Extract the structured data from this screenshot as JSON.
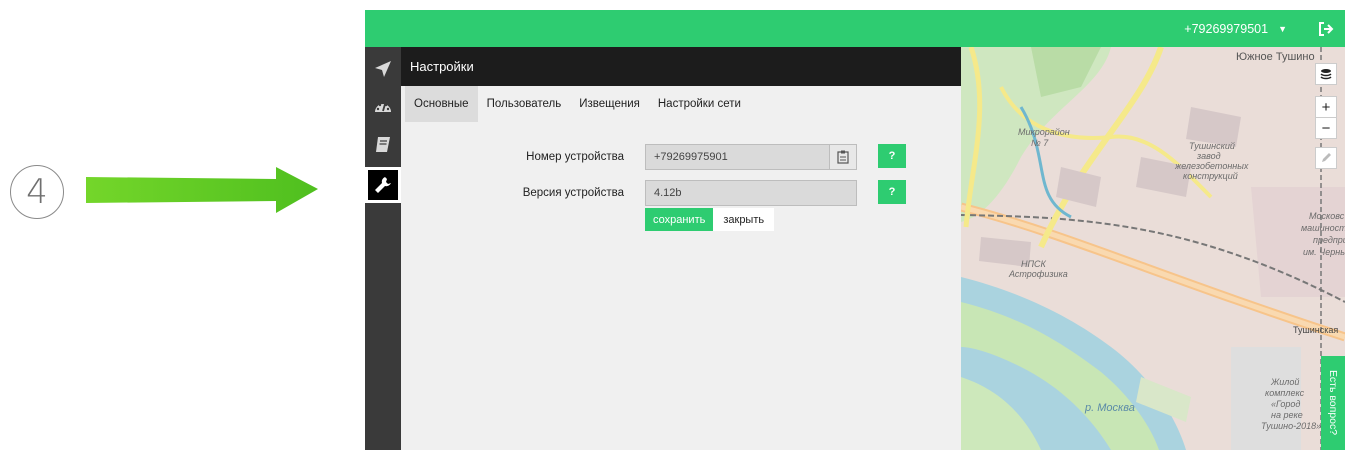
{
  "annotation": {
    "step_number": "4"
  },
  "topbar": {
    "phone": "+79269979501",
    "logout_icon": "sign-out-icon",
    "caret_icon": "caret-down-icon"
  },
  "sidebar": {
    "items": [
      {
        "icon": "location-arrow-icon"
      },
      {
        "icon": "dashboard-icon"
      },
      {
        "icon": "book-icon"
      },
      {
        "icon": "wrench-icon",
        "active": true
      }
    ]
  },
  "panel": {
    "title": "Настройки",
    "tabs": [
      {
        "label": "Основные",
        "active": true
      },
      {
        "label": "Пользователь"
      },
      {
        "label": "Извещения"
      },
      {
        "label": "Настройки сети"
      }
    ],
    "fields": {
      "device_number": {
        "label": "Номер устройства",
        "value": "+79269975901"
      },
      "device_version": {
        "label": "Версия устройства",
        "value": "4.12b"
      }
    },
    "help_label": "?",
    "save_label": "сохранить",
    "close_label": "закрыть"
  },
  "map": {
    "controls": {
      "zoom_in": "+",
      "zoom_out": "−"
    },
    "labels": {
      "yuzhnoe_tushino": "Южное Тушино",
      "mikrorayon": "Микрорайон",
      "mikrorayon_num": "№ 7",
      "tushinsky": "Тушинский",
      "zavod": "завод",
      "zhelezobeton": "железобетонных",
      "konstruktsiy": "конструкций",
      "moskov": "Московс",
      "mashinostro": "машиностро",
      "predpri": "предпри",
      "im_cherny": "им. Черны",
      "npk": "НПСК",
      "astrofizika": "Астрофизика",
      "tushinskaya": "Тушинская",
      "reka_moskva": "р. Москва",
      "zhiloy": "Жилой",
      "kompleks": "комплекс",
      "gorod": "«Город",
      "na_reke": "на реке",
      "tushino_2018": "Тушино-2018»"
    },
    "feedback_label": "Есть вопрос?"
  },
  "colors": {
    "accent": "#2ecc71",
    "sidebar": "#3a3a3a",
    "header": "#1c1c1c"
  }
}
